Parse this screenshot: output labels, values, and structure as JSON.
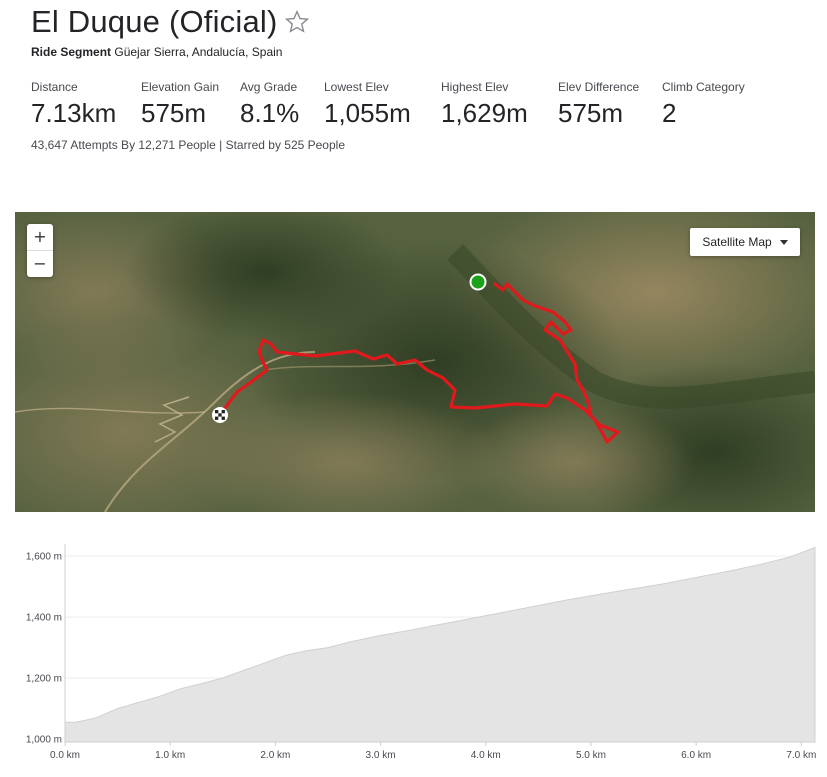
{
  "segment": {
    "title": "El Duque (Oficial)",
    "type_label": "Ride Segment",
    "location": "Güejar Sierra, Andalucía, Spain",
    "star_icon": "star-outline-icon"
  },
  "stats": [
    {
      "label": "Distance",
      "value": "7.13km"
    },
    {
      "label": "Elevation Gain",
      "value": "575m"
    },
    {
      "label": "Avg Grade",
      "value": "8.1%"
    },
    {
      "label": "Lowest Elev",
      "value": "1,055m"
    },
    {
      "label": "Highest Elev",
      "value": "1,629m"
    },
    {
      "label": "Elev Difference",
      "value": "575m"
    },
    {
      "label": "Climb Category",
      "value": "2"
    }
  ],
  "attempts_text": "43,647 Attempts By 12,271 People | Starred by 525 People",
  "map": {
    "zoom_in_label": "+",
    "zoom_out_label": "−",
    "type_selector_label": "Satellite Map",
    "route_color": "#e0191c",
    "start_marker_color": "#1aa31a"
  },
  "chart_data": {
    "type": "area",
    "title": "",
    "xlabel": "",
    "ylabel": "",
    "x_ticks": [
      "0.0 km",
      "1.0 km",
      "2.0 km",
      "3.0 km",
      "4.0 km",
      "5.0 km",
      "6.0 km",
      "7.0 km"
    ],
    "y_ticks": [
      "1,000 m",
      "1,200 m",
      "1,400 m",
      "1,600 m"
    ],
    "xlim": [
      0,
      7.13
    ],
    "ylim": [
      990,
      1640
    ],
    "fill_color": "#e4e4e4",
    "series": [
      {
        "x": [
          0,
          0.1,
          0.2,
          0.3,
          0.4,
          0.5,
          0.7,
          0.9,
          1.1,
          1.3,
          1.5,
          1.7,
          1.9,
          2.1,
          2.3,
          2.5,
          2.7,
          3.0,
          3.3,
          3.6,
          3.9,
          4.2,
          4.5,
          4.8,
          5.1,
          5.4,
          5.7,
          6.0,
          6.3,
          6.6,
          6.9,
          7.13
        ],
        "y": [
          1055,
          1055,
          1062,
          1070,
          1085,
          1100,
          1120,
          1140,
          1165,
          1182,
          1200,
          1225,
          1250,
          1275,
          1290,
          1300,
          1318,
          1340,
          1358,
          1378,
          1398,
          1418,
          1438,
          1458,
          1476,
          1493,
          1510,
          1530,
          1550,
          1572,
          1598,
          1629
        ]
      }
    ]
  }
}
